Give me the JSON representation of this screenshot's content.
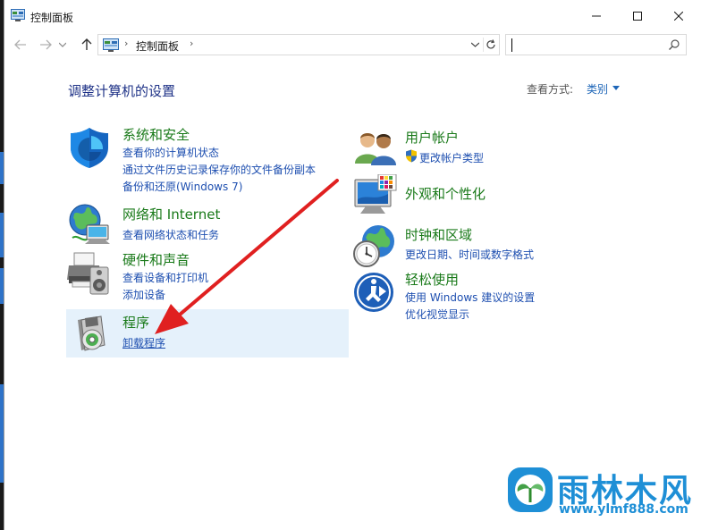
{
  "window": {
    "title": "控制面板",
    "controls": [
      "minimize",
      "maximize",
      "close"
    ]
  },
  "addressbar": {
    "crumbs": [
      "控制面板"
    ],
    "separator": "›"
  },
  "search": {
    "placeholder": "",
    "value": ""
  },
  "main": {
    "heading": "调整计算机的设置",
    "view_by": {
      "label": "查看方式:",
      "value": "类别"
    },
    "left_categories": [
      {
        "title": "系统和安全",
        "icon": "shield-icon",
        "links": [
          "查看你的计算机状态",
          "通过文件历史记录保存你的文件备份副本",
          "备份和还原(Windows 7)"
        ]
      },
      {
        "title": "网络和 Internet",
        "icon": "network-globe-icon",
        "links": [
          "查看网络状态和任务"
        ]
      },
      {
        "title": "硬件和声音",
        "icon": "printer-speaker-icon",
        "links": [
          "查看设备和打印机",
          "添加设备"
        ]
      },
      {
        "title": "程序",
        "icon": "programs-disc-icon",
        "links": [
          "卸载程序"
        ]
      }
    ],
    "right_categories": [
      {
        "title": "用户帐户",
        "icon": "users-icon",
        "links": [
          "更改帐户类型"
        ]
      },
      {
        "title": "外观和个性化",
        "icon": "monitor-palette-icon",
        "links": []
      },
      {
        "title": "时钟和区域",
        "icon": "clock-globe-icon",
        "links": [
          "更改日期、时间或数字格式"
        ]
      },
      {
        "title": "轻松使用",
        "icon": "ease-of-access-icon",
        "links": [
          "使用 Windows 建议的设置",
          "优化视觉显示"
        ]
      }
    ]
  },
  "watermark": {
    "title": "雨林木风",
    "url": "www.ylmf888.com"
  },
  "colors": {
    "heading": "#1e3287",
    "category_title": "#1a7a1a",
    "link": "#1e4fb0",
    "hover_bg": "#e5f1fb",
    "arrow": "#e02020",
    "watermark": "#1e8fd6"
  }
}
